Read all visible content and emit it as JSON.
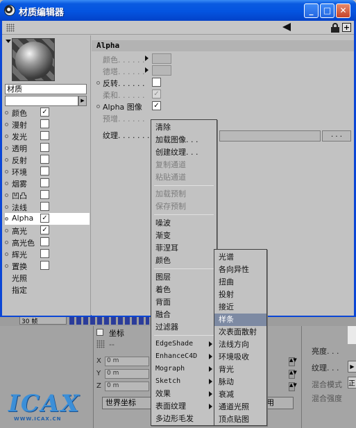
{
  "window": {
    "title": "材质编辑器"
  },
  "toolbar": {
    "back_icon": "back-arrow-icon",
    "lock_icon": "lock-icon",
    "new_icon": "new-window-icon"
  },
  "left": {
    "material_name": "材质",
    "channels": [
      {
        "label": "颜色",
        "checked": true
      },
      {
        "label": "漫射",
        "checked": false
      },
      {
        "label": "发光",
        "checked": false
      },
      {
        "label": "透明",
        "checked": false
      },
      {
        "label": "反射",
        "checked": false
      },
      {
        "label": "环境",
        "checked": false
      },
      {
        "label": "烟雾",
        "checked": false
      },
      {
        "label": "凹凸",
        "checked": false
      },
      {
        "label": "法线",
        "checked": false
      },
      {
        "label": "Alpha",
        "checked": true,
        "selected": true
      },
      {
        "label": "高光",
        "checked": true
      },
      {
        "label": "高光色",
        "checked": false
      },
      {
        "label": "辉光",
        "checked": false
      },
      {
        "label": "置换",
        "checked": false
      }
    ],
    "extra": [
      "光照",
      "指定"
    ]
  },
  "right": {
    "header": "Alpha",
    "props": {
      "color": "颜色. . . . . .",
      "delta": "德塔. . . . . .",
      "invert": "反转. . . . . .",
      "soft": "柔和. . . . . .",
      "alpha_image": "Alpha 图像",
      "premultiply": "预增. . . . . .",
      "texture": "纹理. . . . . . ."
    },
    "checks": {
      "invert": false,
      "soft": true,
      "alpha_image": true
    },
    "texture_more": ". . ."
  },
  "menu1": {
    "items": [
      "清除",
      "加载图像. . .",
      "创建纹理. . .",
      "复制通道",
      "粘贴通道",
      "加载预制",
      "保存预制",
      "噪波",
      "渐变",
      "菲涅耳",
      "颜色",
      "图层",
      "着色",
      "背面",
      "融合",
      "过滤器",
      "EdgeShade",
      "EnhanceC4D",
      "Mograph",
      "Sketch",
      "效果",
      "表面纹理",
      "多边形毛发"
    ]
  },
  "menu2": {
    "items": [
      "光谱",
      "各向异性",
      "扭曲",
      "投射",
      "接近",
      "样条",
      "次表面散射",
      "法线方向",
      "环境吸收",
      "背光",
      "脉动",
      "衰减",
      "通道光照",
      "顶点贴图"
    ],
    "highlighted": "样条"
  },
  "background": {
    "timeline_field": "30 帧",
    "coord_title": "坐标",
    "coord_dash": "--",
    "coords": [
      {
        "axis": "X",
        "value": "0 m"
      },
      {
        "axis": "Y",
        "value": "0 m"
      },
      {
        "axis": "Z",
        "value": "0 m"
      }
    ],
    "world_button": "世界坐标",
    "apply_button": "用",
    "attr": {
      "brightness": "亮度. . .",
      "texture": "纹理. . .",
      "mix_mode": "混合模式",
      "mix_strength": "混合强度",
      "mix_value": "正"
    }
  },
  "logo": {
    "text": "ICAX",
    "url": "WWW.ICAX.CN"
  },
  "colors": {
    "title_bar": "#0454e0",
    "menu_highlight": "#7d8aa3",
    "panel": "#c2c2c2"
  }
}
